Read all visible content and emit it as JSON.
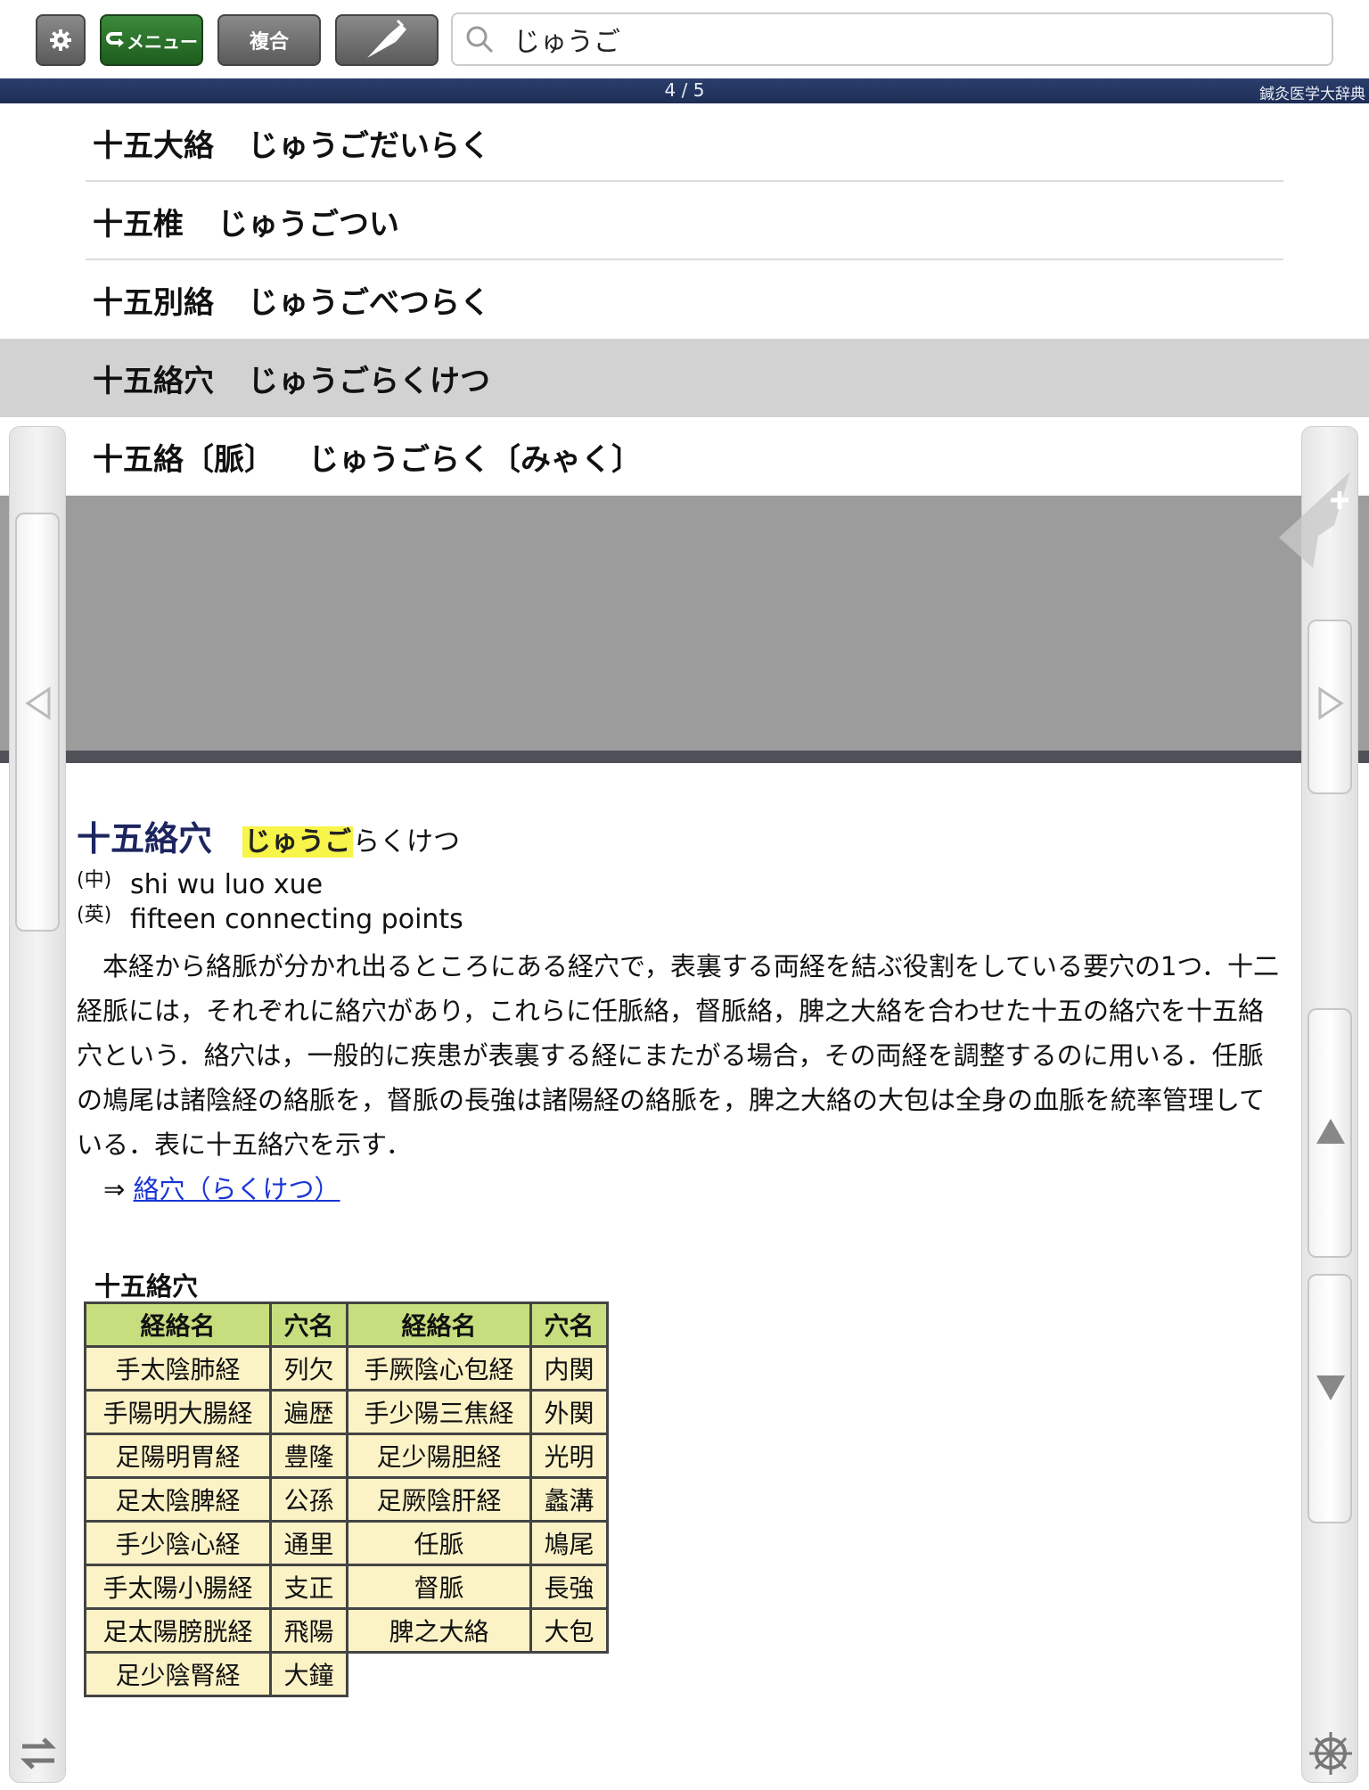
{
  "toolbar": {
    "menu_label": "メニュー",
    "fukugo_label": "複合",
    "search_value": "じゅうご"
  },
  "status": {
    "counter": "4 / 5",
    "dictionary": "鍼灸医学大辞典"
  },
  "results": [
    {
      "kanji": "十五大絡",
      "kana": "じゅうごだいらく"
    },
    {
      "kanji": "十五椎",
      "kana": "じゅうごつい"
    },
    {
      "kanji": "十五別絡",
      "kana": "じゅうごべつらく"
    },
    {
      "kanji": "十五絡穴",
      "kana": "じゅうごらくけつ"
    },
    {
      "kanji": "十五絡〔脈〕",
      "kana": "じゅうごらく〔みゃく〕"
    }
  ],
  "entry": {
    "title": "十五絡穴",
    "reading_highlight": "じゅうご",
    "reading_rest": "らくけつ",
    "zh_tag": "(中)",
    "zh": "shi wu luo xue",
    "en_tag": "(英)",
    "en": "fifteen connecting points",
    "body": "本経から絡脈が分かれ出るところにある経穴で，表裏する両経を結ぶ役割をしている要穴の1つ．十二経脈には，それぞれに絡穴があり，これらに任脈絡，督脈絡，脾之大絡を合わせた十五の絡穴を十五絡穴という．絡穴は，一般的に疾患が表裏する経にまたがる場合，その両経を調整するのに用いる．任脈の鳩尾は諸陰経の絡脈を，督脈の長強は諸陽経の絡脈を，脾之大絡の大包は全身の血脈を統率管理している．表に十五絡穴を示す．",
    "ref_arrow": "⇒",
    "ref_link": "絡穴（らくけつ）"
  },
  "table": {
    "title": "十五絡穴",
    "headers": [
      "経絡名",
      "穴名",
      "経絡名",
      "穴名"
    ],
    "rows": [
      [
        "手太陰肺経",
        "列欠",
        "手厥陰心包経",
        "内関"
      ],
      [
        "手陽明大腸経",
        "遍歴",
        "手少陽三焦経",
        "外関"
      ],
      [
        "足陽明胃経",
        "豊隆",
        "足少陽胆経",
        "光明"
      ],
      [
        "足太陰脾経",
        "公孫",
        "足厥陰肝経",
        "蠡溝"
      ],
      [
        "手少陰心経",
        "通里",
        "任脈",
        "鳩尾"
      ],
      [
        "手太陽小腸経",
        "支正",
        "督脈",
        "長強"
      ],
      [
        "足太陽膀胱経",
        "飛陽",
        "脾之大絡",
        "大包"
      ],
      [
        "足少陰腎経",
        "大鐘",
        "",
        ""
      ]
    ]
  },
  "icons": {
    "settings": "gear-icon",
    "menu": "return-arrow-icon",
    "pen": "pen-icon",
    "search": "search-icon",
    "bookmark": "plus-icon",
    "prev": "triangle-left-icon",
    "next": "triangle-right-icon",
    "scroll_up": "triangle-up-icon",
    "scroll_down": "triangle-down-icon",
    "swap": "swap-arrows-icon",
    "wheel": "dharma-wheel-icon"
  },
  "colors": {
    "menu_button": "#1d5c1d",
    "status_bar": "#2b3f6d",
    "title": "#1d2560",
    "highlight": "#f7f44a",
    "link": "#1a35d6",
    "table_header": "#c7de7e",
    "table_cell": "#fbf2c6",
    "selected_row": "#d2d2d2"
  }
}
